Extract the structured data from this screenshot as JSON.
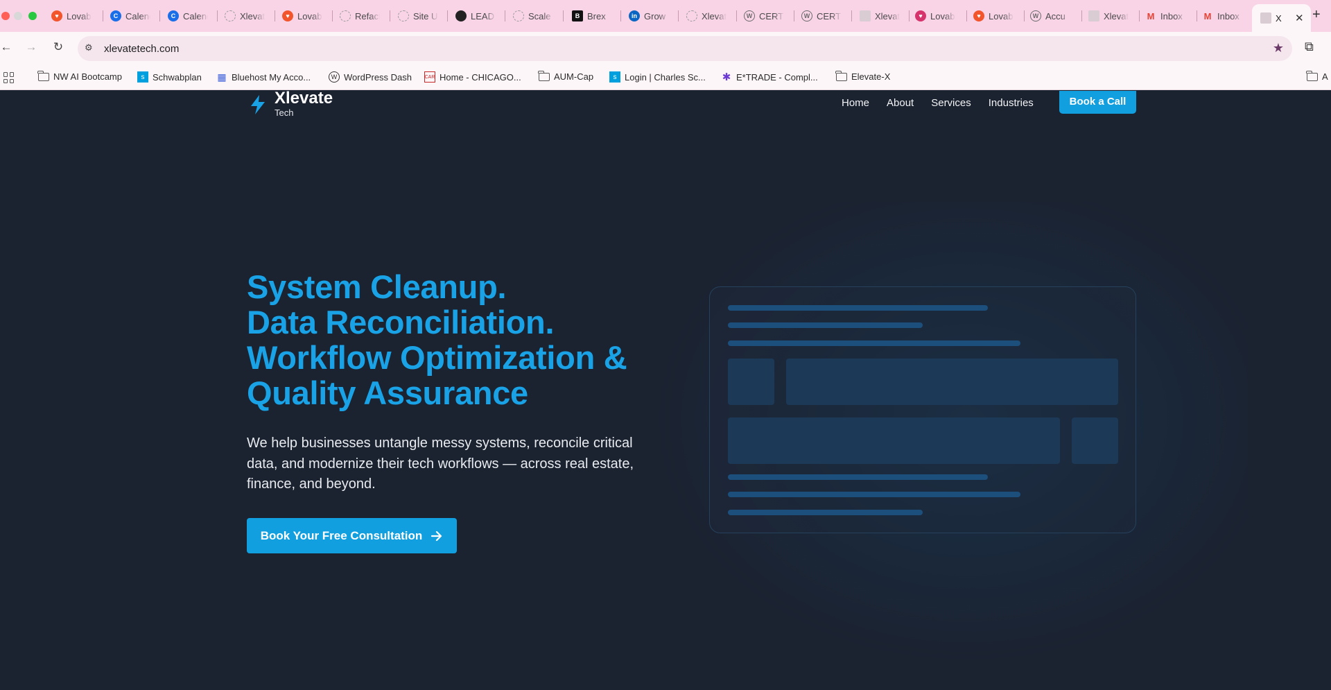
{
  "browser": {
    "tabs": [
      {
        "label": "Lovable",
        "icon": "lovable-heart-icon",
        "color": "#f2552c"
      },
      {
        "label": "Calendar",
        "icon": "calendly-icon",
        "color": "#1a6fe8"
      },
      {
        "label": "Calendar",
        "icon": "calendly-icon",
        "color": "#1a6fe8"
      },
      {
        "label": "Xlevate",
        "icon": "globe-icon",
        "color": "#9a9a9a"
      },
      {
        "label": "Lovable",
        "icon": "lovable-heart-icon",
        "color": "#f2552c"
      },
      {
        "label": "Refactor",
        "icon": "globe-icon",
        "color": "#9a9a9a"
      },
      {
        "label": "Site U",
        "icon": "globe-icon",
        "color": "#9a9a9a"
      },
      {
        "label": "LEAD",
        "icon": "dark-circle-icon",
        "color": "#222222"
      },
      {
        "label": "Scale",
        "icon": "globe-icon",
        "color": "#9a9a9a"
      },
      {
        "label": "Brex",
        "icon": "brex-icon",
        "color": "#111111"
      },
      {
        "label": "Grow",
        "icon": "linkedin-icon",
        "color": "#0a66c2"
      },
      {
        "label": "Xlevate",
        "icon": "globe-icon",
        "color": "#9a9a9a"
      },
      {
        "label": "CERT",
        "icon": "wordpress-icon",
        "color": "#6b6b6b"
      },
      {
        "label": "CERT",
        "icon": "wordpress-icon",
        "color": "#6b6b6b"
      },
      {
        "label": "Xlevate",
        "icon": "page-icon",
        "color": "#b5b5b5"
      },
      {
        "label": "Lovable",
        "icon": "lovable-heart-icon",
        "color": "#d6336c"
      },
      {
        "label": "Lovable",
        "icon": "lovable-heart-icon",
        "color": "#f2552c"
      },
      {
        "label": "Accu",
        "icon": "wordpress-icon",
        "color": "#6b6b6b"
      },
      {
        "label": "Xlevate",
        "icon": "page-icon",
        "color": "#b5b5b5"
      },
      {
        "label": "Inbox",
        "icon": "gmail-icon",
        "color": "#ea4335"
      },
      {
        "label": "Inbox",
        "icon": "gmail-icon",
        "color": "#ea4335"
      }
    ],
    "active_tab": {
      "label": "X",
      "icon": "page-icon"
    },
    "url": "xlevatetech.com",
    "bookmarks": [
      {
        "label": "NW AI Bootcamp",
        "icon": "folder-icon"
      },
      {
        "label": "Schwabplan",
        "icon": "schwab-icon"
      },
      {
        "label": "Bluehost My Acco...",
        "icon": "bluehost-grid-icon"
      },
      {
        "label": "WordPress Dash",
        "icon": "wordpress-icon"
      },
      {
        "label": "Home - CHICAGO...",
        "icon": "car-icon"
      },
      {
        "label": "AUM-Cap",
        "icon": "folder-icon"
      },
      {
        "label": "Login | Charles Sc...",
        "icon": "schwab-icon"
      },
      {
        "label": "E*TRADE - Compl...",
        "icon": "etrade-star-icon"
      },
      {
        "label": "Elevate-X",
        "icon": "folder-icon"
      },
      {
        "label": "A",
        "icon": "folder-icon"
      }
    ]
  },
  "site": {
    "brand": {
      "name": "Xlevate",
      "sub": "Tech"
    },
    "nav": [
      "Home",
      "About",
      "Services",
      "Industries"
    ],
    "nav_cta": "Book a Call",
    "headline": [
      "System Cleanup.",
      "Data Reconciliation.",
      "Workflow Optimization &",
      "Quality Assurance"
    ],
    "subtext": "We help businesses untangle messy systems, reconcile critical data, and modernize their tech workflows — across real estate, finance, and beyond.",
    "cta": "Book Your Free Consultation",
    "colors": {
      "accent": "#129fe0",
      "headline": "#1aa2e6",
      "background": "#1b2230"
    }
  }
}
